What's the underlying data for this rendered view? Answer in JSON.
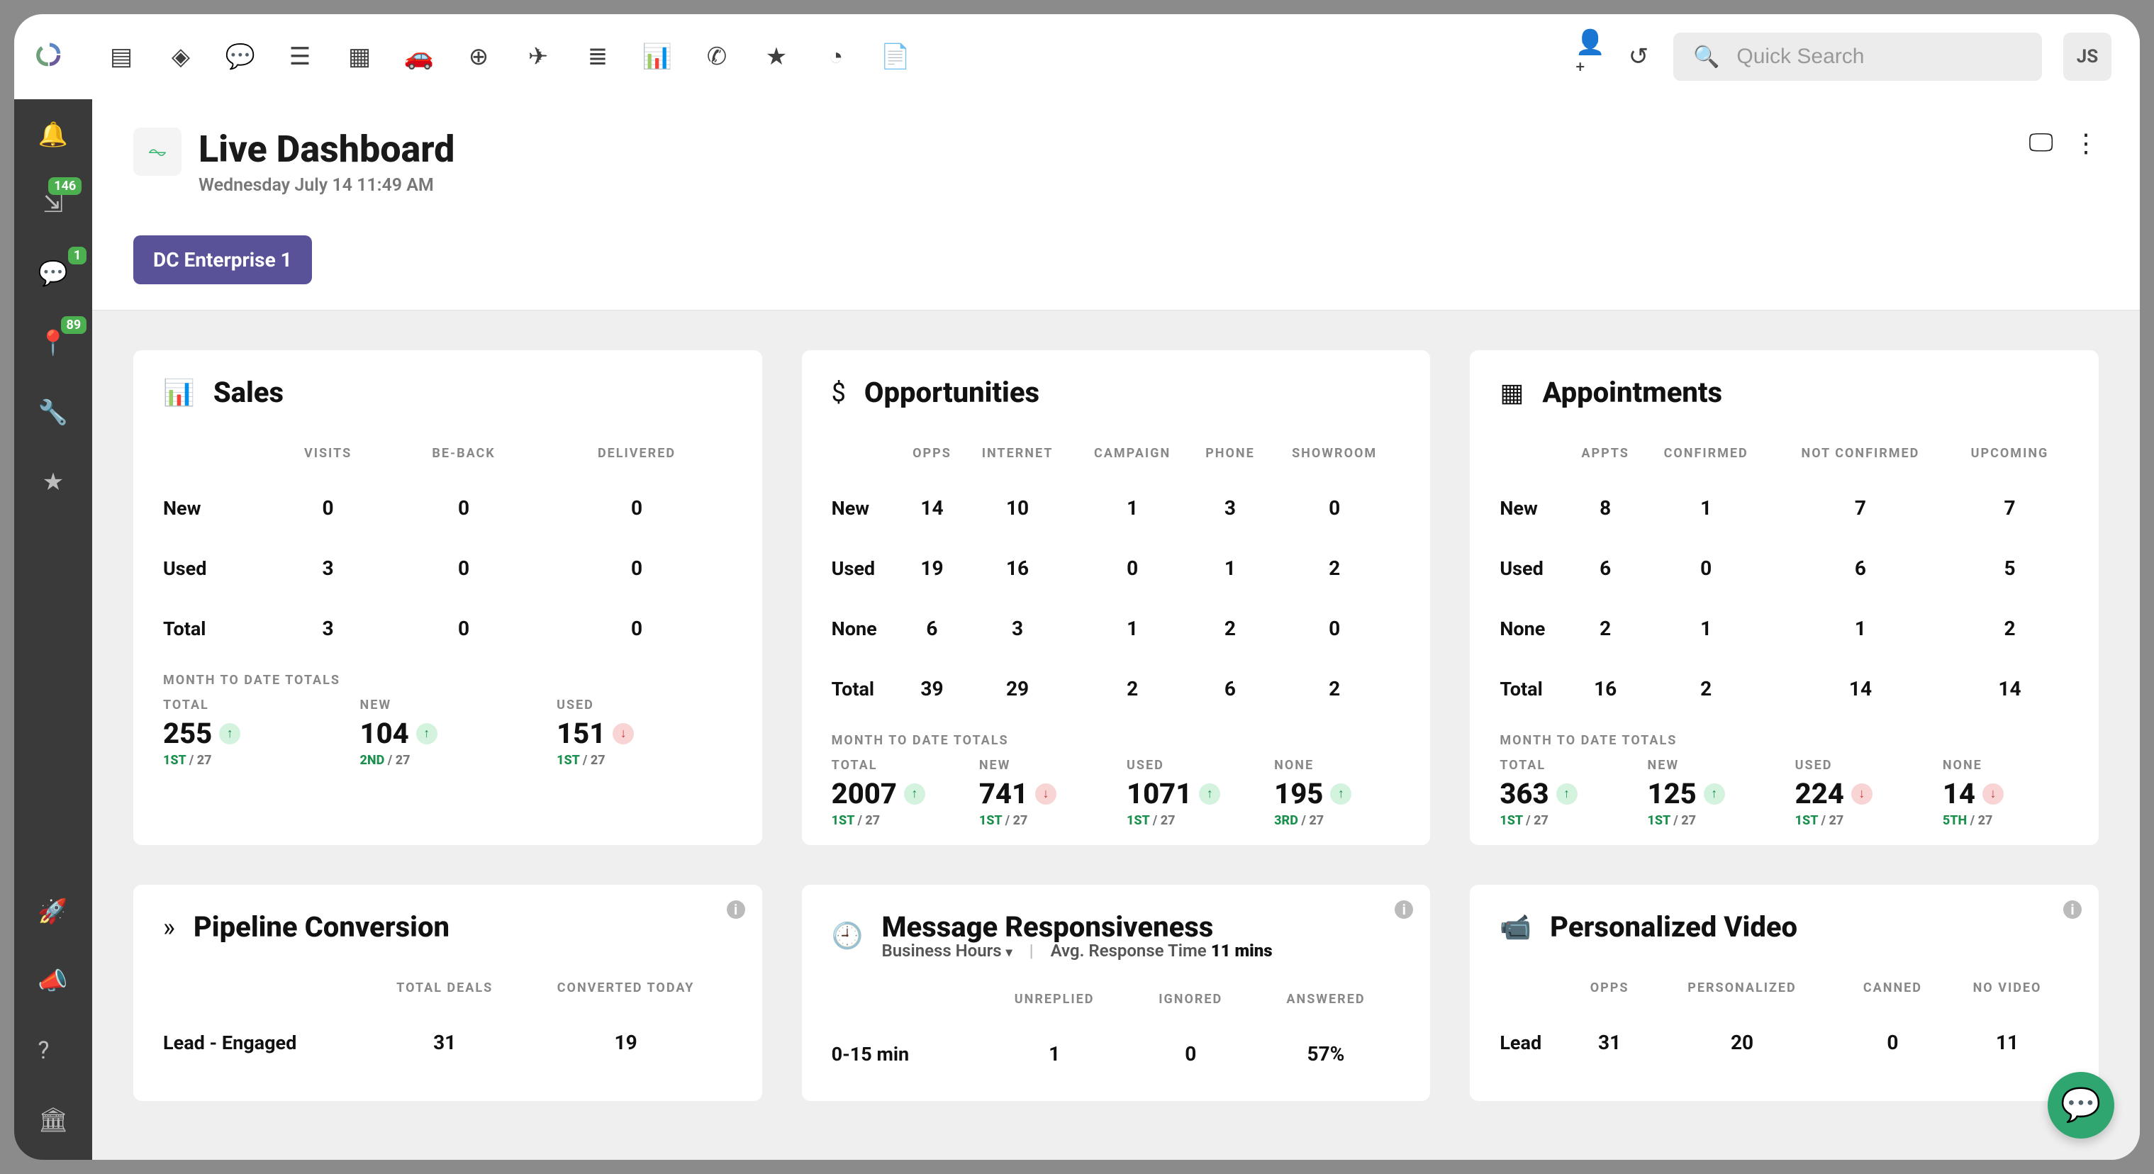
{
  "header": {
    "title": "Live Dashboard",
    "datetime": "Wednesday July 14 11:49 AM",
    "tab": "DC Enterprise 1",
    "search_placeholder": "Quick Search",
    "user_initials": "JS"
  },
  "sidebar_badges": {
    "a": "146",
    "b": "1",
    "c": "89"
  },
  "cards": {
    "sales": {
      "title": "Sales",
      "cols": [
        "VISITS",
        "BE-BACK",
        "DELIVERED"
      ],
      "rows": [
        {
          "label": "New",
          "v": [
            "0",
            "0",
            "0"
          ]
        },
        {
          "label": "Used",
          "v": [
            "3",
            "0",
            "0"
          ]
        },
        {
          "label": "Total",
          "v": [
            "3",
            "0",
            "0"
          ]
        }
      ],
      "mtd_label": "MONTH TO DATE TOTALS",
      "mtd": [
        {
          "cap": "TOTAL",
          "val": "255",
          "dir": "up",
          "rank": "1ST",
          "denom": "27"
        },
        {
          "cap": "NEW",
          "val": "104",
          "dir": "up",
          "rank": "2ND",
          "denom": "27"
        },
        {
          "cap": "USED",
          "val": "151",
          "dir": "down",
          "rank": "1ST",
          "denom": "27"
        }
      ]
    },
    "opps": {
      "title": "Opportunities",
      "cols": [
        "OPPS",
        "INTERNET",
        "CAMPAIGN",
        "PHONE",
        "SHOWROOM"
      ],
      "rows": [
        {
          "label": "New",
          "v": [
            "14",
            "10",
            "1",
            "3",
            "0"
          ]
        },
        {
          "label": "Used",
          "v": [
            "19",
            "16",
            "0",
            "1",
            "2"
          ]
        },
        {
          "label": "None",
          "v": [
            "6",
            "3",
            "1",
            "2",
            "0"
          ]
        },
        {
          "label": "Total",
          "v": [
            "39",
            "29",
            "2",
            "6",
            "2"
          ]
        }
      ],
      "mtd_label": "MONTH TO DATE TOTALS",
      "mtd": [
        {
          "cap": "TOTAL",
          "val": "2007",
          "dir": "up",
          "rank": "1ST",
          "denom": "27"
        },
        {
          "cap": "NEW",
          "val": "741",
          "dir": "down",
          "rank": "1ST",
          "denom": "27"
        },
        {
          "cap": "USED",
          "val": "1071",
          "dir": "up",
          "rank": "1ST",
          "denom": "27"
        },
        {
          "cap": "NONE",
          "val": "195",
          "dir": "up",
          "rank": "3RD",
          "denom": "27"
        }
      ]
    },
    "appts": {
      "title": "Appointments",
      "cols": [
        "APPTS",
        "CONFIRMED",
        "NOT CONFIRMED",
        "UPCOMING"
      ],
      "rows": [
        {
          "label": "New",
          "v": [
            "8",
            "1",
            "7",
            "7"
          ]
        },
        {
          "label": "Used",
          "v": [
            "6",
            "0",
            "6",
            "5"
          ]
        },
        {
          "label": "None",
          "v": [
            "2",
            "1",
            "1",
            "2"
          ]
        },
        {
          "label": "Total",
          "v": [
            "16",
            "2",
            "14",
            "14"
          ]
        }
      ],
      "mtd_label": "MONTH TO DATE TOTALS",
      "mtd": [
        {
          "cap": "TOTAL",
          "val": "363",
          "dir": "up",
          "rank": "1ST",
          "denom": "27"
        },
        {
          "cap": "NEW",
          "val": "125",
          "dir": "up",
          "rank": "1ST",
          "denom": "27"
        },
        {
          "cap": "USED",
          "val": "224",
          "dir": "down",
          "rank": "1ST",
          "denom": "27"
        },
        {
          "cap": "NONE",
          "val": "14",
          "dir": "down",
          "rank": "5TH",
          "denom": "27"
        }
      ]
    },
    "pipeline": {
      "title": "Pipeline Conversion",
      "cols": [
        "TOTAL DEALS",
        "CONVERTED TODAY"
      ],
      "rows": [
        {
          "label": "Lead - Engaged",
          "v": [
            "31",
            "19"
          ]
        }
      ]
    },
    "msg": {
      "title": "Message Responsiveness",
      "sub1": "Business Hours",
      "sub2": "Avg. Response Time",
      "sub2b": "11 mins",
      "cols": [
        "UNREPLIED",
        "IGNORED",
        "ANSWERED"
      ],
      "rows": [
        {
          "label": "0-15 min",
          "v": [
            "1",
            "0",
            "57%"
          ]
        }
      ]
    },
    "video": {
      "title": "Personalized Video",
      "cols": [
        "OPPS",
        "PERSONALIZED",
        "CANNED",
        "NO VIDEO"
      ],
      "rows": [
        {
          "label": "Lead",
          "v": [
            "31",
            "20",
            "0",
            "11"
          ]
        }
      ]
    }
  }
}
